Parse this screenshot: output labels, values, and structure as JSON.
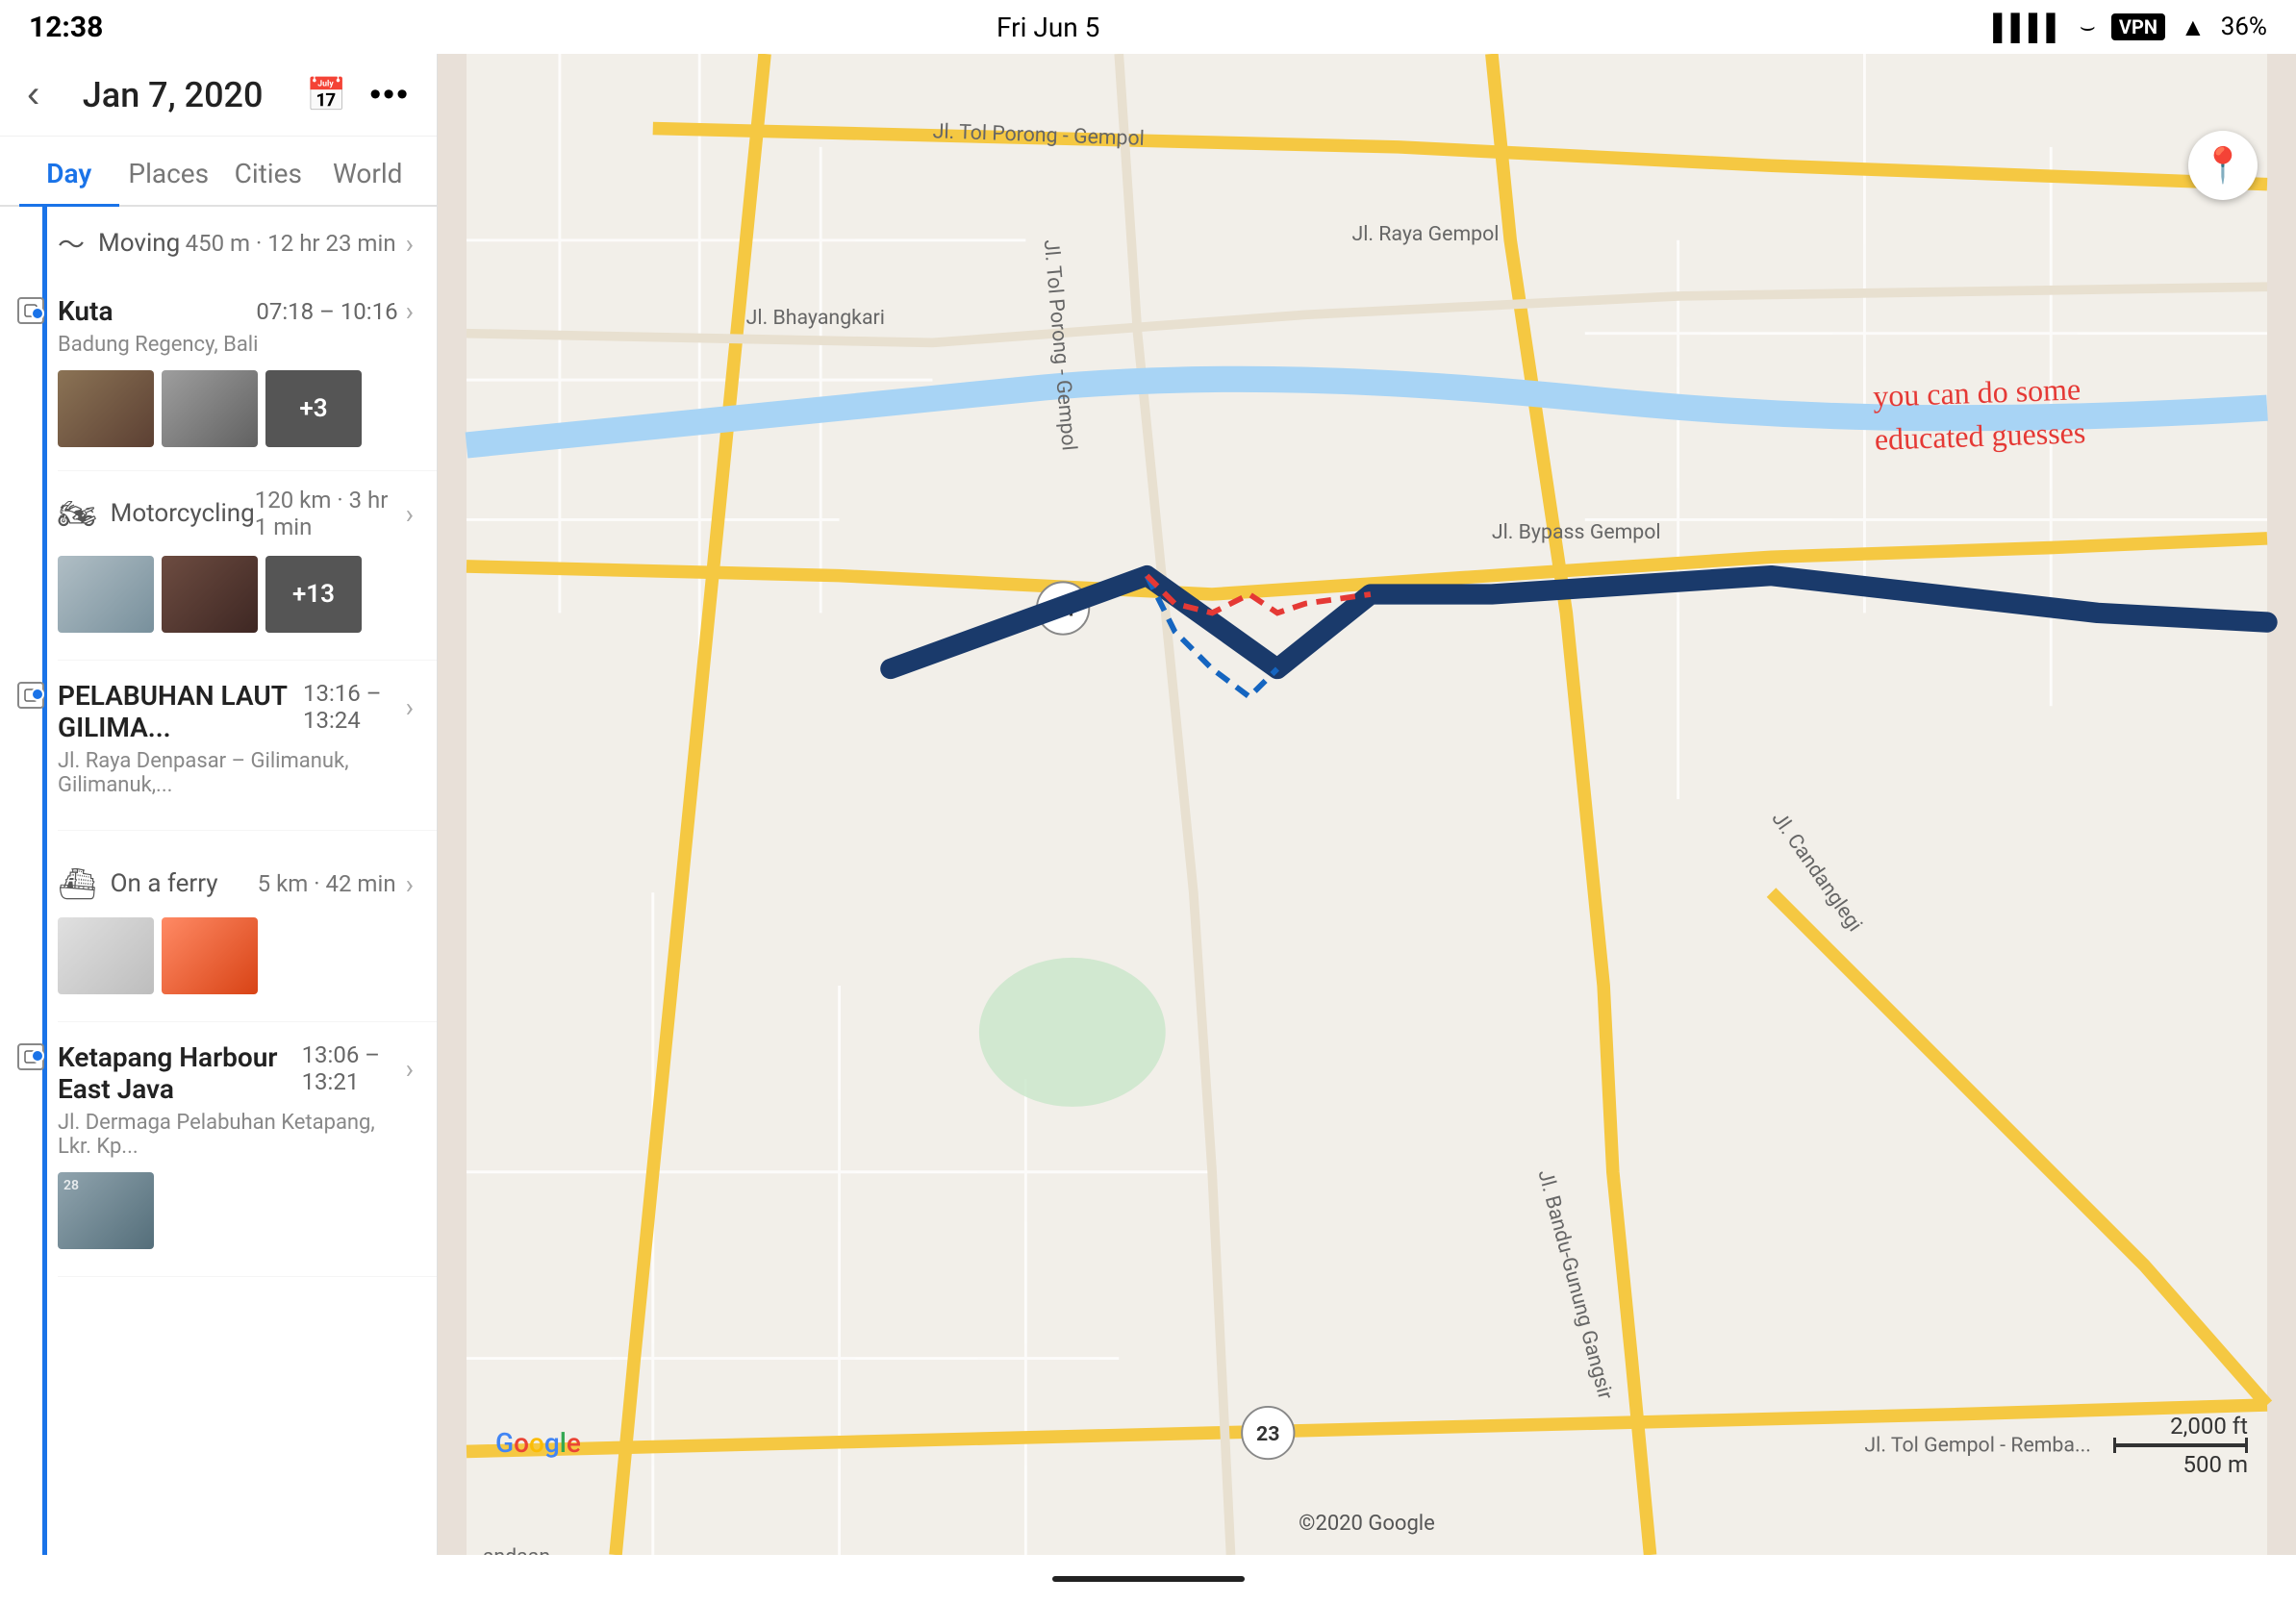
{
  "statusBar": {
    "time": "12:38",
    "date": "Fri Jun 5",
    "signal": "●●●●",
    "vpn": "VPN",
    "battery": "36%"
  },
  "header": {
    "title": "Jan 7, 2020",
    "back": "<",
    "calendar_icon": "📅",
    "more_icon": "•••"
  },
  "tabs": [
    {
      "label": "Day",
      "active": true
    },
    {
      "label": "Places",
      "active": false
    },
    {
      "label": "Cities",
      "active": false
    },
    {
      "label": "World",
      "active": false
    }
  ],
  "timeline": {
    "items": [
      {
        "type": "moving",
        "icon": "〜",
        "label": "Moving",
        "distance": "450 m · 12 hr 23 min"
      },
      {
        "type": "stop",
        "name": "Kuta",
        "address": "Badung Regency, Bali",
        "time": "07:18 – 10:16",
        "photos": 5,
        "more_count": "+3"
      },
      {
        "type": "transport",
        "icon": "🏍",
        "label": "Motorcycling",
        "distance": "120 km · 3 hr 1 min",
        "photos": 3,
        "more_count": "+13"
      },
      {
        "type": "stop",
        "name": "PELABUHAN LAUT GILIMA...",
        "address": "Jl. Raya Denpasar – Gilimanuk, Gilimanuk,...",
        "time": "13:16 – 13:24"
      },
      {
        "type": "transport",
        "icon": "⛴",
        "label": "On a ferry",
        "distance": "5 km · 42 min",
        "photos": 2
      },
      {
        "type": "stop",
        "name": "Ketapang Harbour East Java",
        "address": "Jl. Dermaga Pelabuhan Ketapang, Lkr. Kp...",
        "time": "13:06 – 13:21",
        "photos": 1
      }
    ]
  },
  "map": {
    "annotation": "you can do some\neducated guesses",
    "google_logo": "Google",
    "copyright": "©2020 Google",
    "scale_ft": "2,000 ft",
    "scale_m": "500 m",
    "location_icon": "📍"
  }
}
